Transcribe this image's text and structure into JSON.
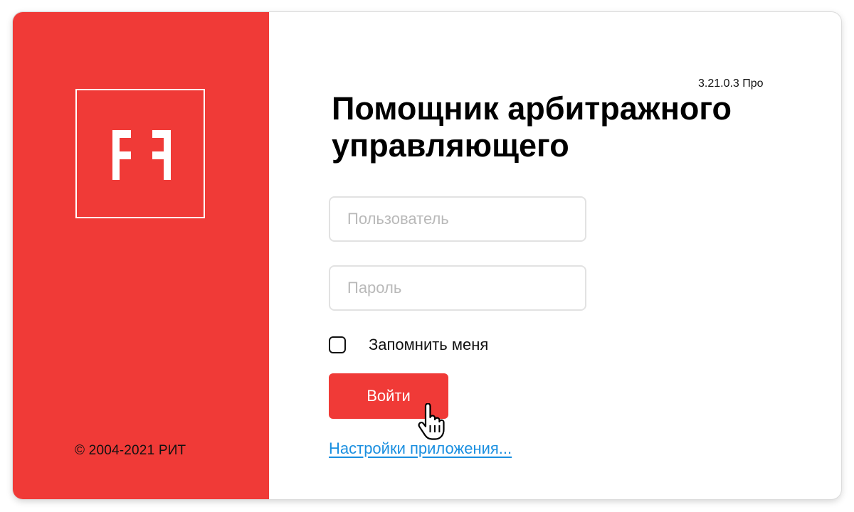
{
  "brand": {
    "logo_icon": "ff-logo-icon",
    "copyright": "© 2004-2021 РИТ",
    "accent_color": "#f03a37"
  },
  "header": {
    "version": "3.21.0.3 Про",
    "title": "Помощник арбитражного управляющего"
  },
  "form": {
    "username": {
      "value": "",
      "placeholder": "Пользователь"
    },
    "password": {
      "value": "",
      "placeholder": "Пароль"
    },
    "remember": {
      "label": "Запомнить меня",
      "checked": false
    },
    "login_label": "Войти",
    "settings_link": "Настройки приложения..."
  },
  "pointer": {
    "icon": "hand-pointer-icon"
  }
}
